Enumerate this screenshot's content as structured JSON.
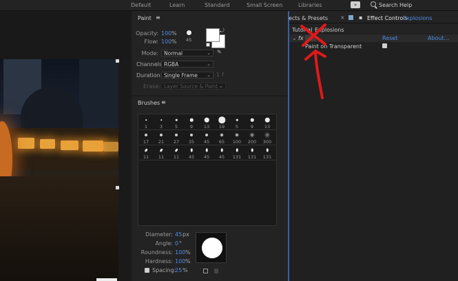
{
  "workspace_tabs": [
    "Default",
    "Learn",
    "Standard",
    "Small Screen",
    "Libraries"
  ],
  "search": {
    "label": "Search Help",
    "more_label": "»"
  },
  "paint": {
    "title": "Paint",
    "menu_glyph": "≡",
    "opacity_label": "Opacity:",
    "opacity_value": "100",
    "flow_label": "Flow:",
    "flow_value": "100",
    "percent_unit": "%",
    "brush_tip_size": "45",
    "mode_label": "Mode:",
    "mode_value": "Normal",
    "channels_label": "Channels:",
    "channels_value": "RGBA",
    "duration_label": "Duration:",
    "duration_value": "Single Frame",
    "duration_suffix": "f",
    "erase_label": "Erase:",
    "erase_value": "Layer Source & Paint"
  },
  "brushes": {
    "title": "Brushes",
    "menu_glyph": "≡",
    "rows": [
      [
        1,
        3,
        5,
        9,
        13,
        19,
        5,
        9,
        13
      ],
      [
        17,
        21,
        27,
        35,
        45,
        65,
        100,
        200,
        300
      ],
      [
        11,
        11,
        11,
        45,
        45,
        45,
        131,
        131,
        131
      ]
    ],
    "diameter_label": "Diameter:",
    "diameter_value": "45",
    "diameter_unit": "px",
    "angle_label": "Angle:",
    "angle_value": "0",
    "angle_unit": "°",
    "roundness_label": "Roundness:",
    "roundness_value": "100",
    "hardness_label": "Hardness:",
    "hardness_value": "100",
    "spacing_label": "Spacing:",
    "spacing_value": "25",
    "unit_percent": "%"
  },
  "effect_controls": {
    "tab_presets": "ects & Presets",
    "tab_close": "×",
    "tab_label": "Effect Controls",
    "tab_layer": "Explosions",
    "breadcrumb_comp": "Tutorial",
    "breadcrumb_sep": "·",
    "breadcrumb_layer": "Explosions",
    "fx_label": "fx",
    "reset_label": "Reset",
    "about_label": "About...",
    "property_label": "Paint on Transparent",
    "annotation_color": "#e01919"
  },
  "colors": {
    "accent": "#4f8fe6",
    "panel_bg": "#232323",
    "annotation": "#e01919"
  }
}
